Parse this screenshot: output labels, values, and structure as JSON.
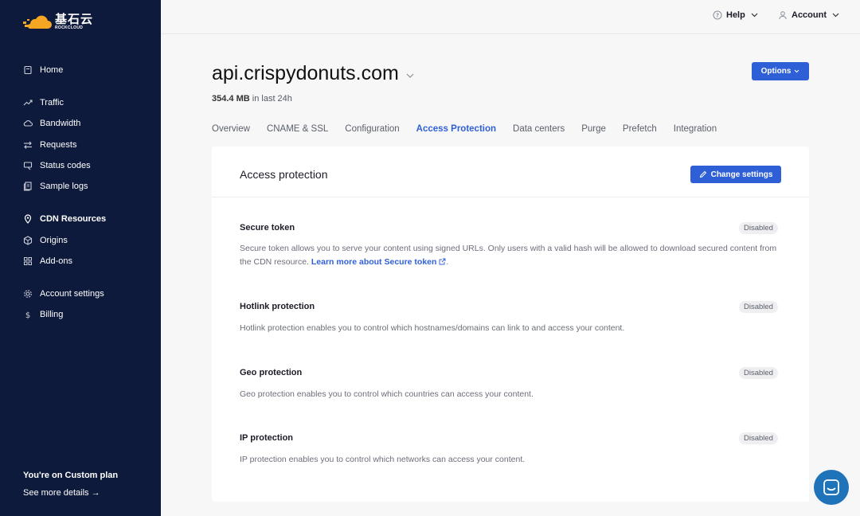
{
  "brand": {
    "name_cn": "基石云",
    "name_en": "ROCKCLOUD",
    "colors": {
      "sidebar": "#0e1a3b",
      "logo": "#f5a623",
      "primary": "#2f5fd6",
      "chat": "#1e73b9"
    }
  },
  "sidebar": {
    "items": [
      {
        "label": "Home",
        "icon": "home-icon"
      },
      {
        "label": "Traffic",
        "icon": "trending-up-icon"
      },
      {
        "label": "Bandwidth",
        "icon": "cloud-icon"
      },
      {
        "label": "Requests",
        "icon": "arrows-icon"
      },
      {
        "label": "Status codes",
        "icon": "flag-icon"
      },
      {
        "label": "Sample logs",
        "icon": "logs-icon"
      },
      {
        "label": "CDN Resources",
        "icon": "location-pin-icon"
      },
      {
        "label": "Origins",
        "icon": "server-icon"
      },
      {
        "label": "Add-ons",
        "icon": "grid-icon"
      },
      {
        "label": "Account settings",
        "icon": "gear-icon"
      },
      {
        "label": "Billing",
        "icon": "dollar-icon"
      }
    ],
    "plan_title": "You're on Custom plan",
    "plan_link": "See more details →"
  },
  "topbar": {
    "help_label": "Help",
    "account_label": "Account"
  },
  "header": {
    "domain": "api.crispydonuts.com",
    "usage_value": "354.4 MB",
    "usage_suffix": " in last 24h",
    "options_label": "Options"
  },
  "tabs": [
    {
      "label": "Overview"
    },
    {
      "label": "CNAME & SSL"
    },
    {
      "label": "Configuration"
    },
    {
      "label": "Access Protection",
      "active": true
    },
    {
      "label": "Data centers"
    },
    {
      "label": "Purge"
    },
    {
      "label": "Prefetch"
    },
    {
      "label": "Integration"
    }
  ],
  "card": {
    "title": "Access protection",
    "change_button": "Change settings",
    "sections": [
      {
        "title": "Secure token",
        "status": "Disabled",
        "description": "Secure token allows you to serve your content using signed URLs. Only users with a valid hash will be allowed to download secured content from the CDN resource. ",
        "link_text": "Learn more about Secure token",
        "link_suffix": "."
      },
      {
        "title": "Hotlink protection",
        "status": "Disabled",
        "description": "Hotlink protection enables you to control which hostnames/domains can link to and access your content."
      },
      {
        "title": "Geo protection",
        "status": "Disabled",
        "description": "Geo protection enables you to control which countries can access your content."
      },
      {
        "title": "IP protection",
        "status": "Disabled",
        "description": "IP protection enables you to control which networks can access your content."
      }
    ]
  }
}
